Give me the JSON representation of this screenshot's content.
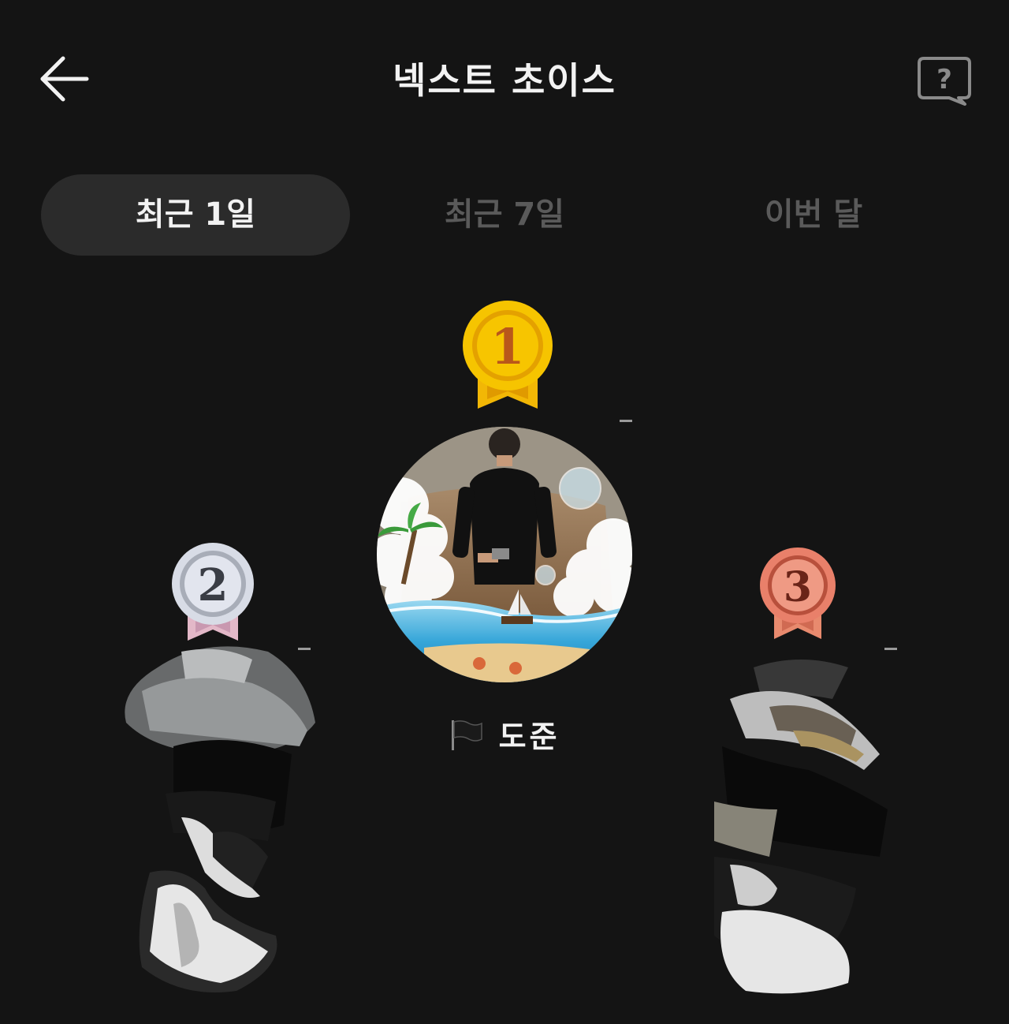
{
  "header": {
    "title": "넥스트 초이스",
    "back_icon": "arrow-left-icon",
    "help_icon": "question-bubble-icon"
  },
  "tabs": [
    {
      "label": "최근 1일",
      "active": true
    },
    {
      "label": "최근 7일",
      "active": false
    },
    {
      "label": "이번 달",
      "active": false
    }
  ],
  "ranking": {
    "first": {
      "rank": "1",
      "medal_color": "#f5b800",
      "change": "–",
      "flag_icon": "black-flag-icon",
      "name": "도준"
    },
    "second": {
      "rank": "2",
      "medal_color": "#c9ccd4",
      "change": "–"
    },
    "third": {
      "rank": "3",
      "medal_color": "#e27a63",
      "change": "–"
    }
  },
  "colors": {
    "background": "#141414",
    "active_tab": "#2b2b2b",
    "inactive_text": "#5a5a5a",
    "text": "#f2f2f2"
  }
}
